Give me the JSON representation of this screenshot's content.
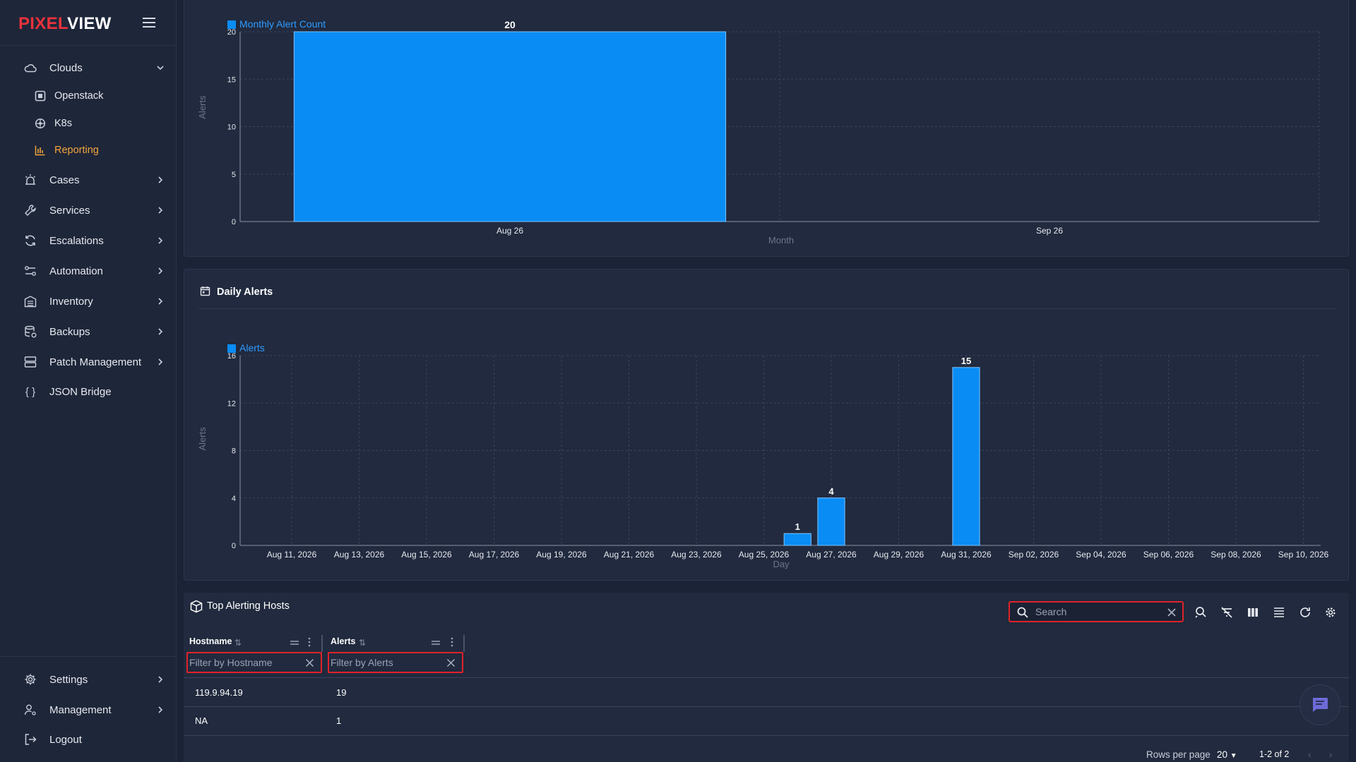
{
  "brand": {
    "part1": "PIXEL",
    "part2": "VIEW",
    "color1": "#e8333c",
    "color2": "#ffffff"
  },
  "sidebar": {
    "items": [
      {
        "label": "Clouds",
        "icon": "cloud-icon",
        "expanded": true
      },
      {
        "label": "Openstack",
        "icon": "openstack-icon"
      },
      {
        "label": "K8s",
        "icon": "kubernetes-icon"
      },
      {
        "label": "Reporting",
        "icon": "bar-chart-icon",
        "active": true
      },
      {
        "label": "Cases",
        "icon": "alarm-icon"
      },
      {
        "label": "Services",
        "icon": "wrench-icon"
      },
      {
        "label": "Escalations",
        "icon": "sync-icon"
      },
      {
        "label": "Automation",
        "icon": "automation-icon"
      },
      {
        "label": "Inventory",
        "icon": "inventory-icon"
      },
      {
        "label": "Backups",
        "icon": "database-icon"
      },
      {
        "label": "Patch Management",
        "icon": "server-icon"
      },
      {
        "label": "JSON Bridge",
        "icon": "braces-icon"
      }
    ],
    "bottom": [
      {
        "label": "Settings",
        "icon": "gear-icon"
      },
      {
        "label": "Management",
        "icon": "user-cog-icon"
      },
      {
        "label": "Logout",
        "icon": "logout-icon"
      }
    ]
  },
  "colors": {
    "accent": "#0a8cf5",
    "active": "#f3a43b",
    "highlight": "#e0232a"
  },
  "monthly_chart": {
    "legend": "Monthly Alert Count",
    "xlabel": "Month",
    "ylabel": "Alerts"
  },
  "daily_panel": {
    "title": "Daily Alerts",
    "icon": "calendar-icon"
  },
  "daily_chart": {
    "legend": "Alerts",
    "xlabel": "Day",
    "ylabel": "Alerts"
  },
  "chart_data": [
    {
      "type": "bar",
      "series": [
        {
          "name": "Monthly Alert Count",
          "values": [
            20,
            null
          ]
        }
      ],
      "categories": [
        "Aug 26",
        "Sep 26"
      ],
      "values": [
        20,
        null
      ],
      "xlabel": "Month",
      "ylabel": "Alerts",
      "ylim": [
        0,
        20
      ],
      "yticks": [
        0,
        5,
        10,
        15,
        20
      ],
      "grid": true,
      "legend": "top-left"
    },
    {
      "type": "bar",
      "series": [
        {
          "name": "Alerts"
        }
      ],
      "xlabel": "Day",
      "ylabel": "Alerts",
      "ylim": [
        0,
        16
      ],
      "yticks": [
        0,
        4,
        8,
        12,
        16
      ],
      "xticks": [
        "Aug 11, 2026",
        "Aug 13, 2026",
        "Aug 15, 2026",
        "Aug 17, 2026",
        "Aug 19, 2026",
        "Aug 21, 2026",
        "Aug 23, 2026",
        "Aug 25, 2026",
        "Aug 27, 2026",
        "Aug 29, 2026",
        "Aug 31, 2026",
        "Sep 02, 2026",
        "Sep 04, 2026",
        "Sep 06, 2026",
        "Sep 08, 2026",
        "Sep 10, 2026"
      ],
      "x": [
        "Aug 26, 2026",
        "Aug 27, 2026",
        "Aug 31, 2026"
      ],
      "values": [
        1,
        4,
        15
      ],
      "grid": true,
      "legend": "top-left"
    }
  ],
  "table": {
    "title": "Top Alerting Hosts",
    "icon": "boxes-icon",
    "search_placeholder": "Search",
    "columns": [
      {
        "label": "Hostname",
        "filter_placeholder": "Filter by Hostname"
      },
      {
        "label": "Alerts",
        "filter_placeholder": "Filter by Alerts"
      }
    ],
    "rows": [
      {
        "hostname": "119.9.94.19",
        "alerts": "19"
      },
      {
        "hostname": "NA",
        "alerts": "1"
      }
    ],
    "rows_per_page_label": "Rows per page",
    "rows_per_page": "20",
    "range": "1-2 of 2"
  }
}
